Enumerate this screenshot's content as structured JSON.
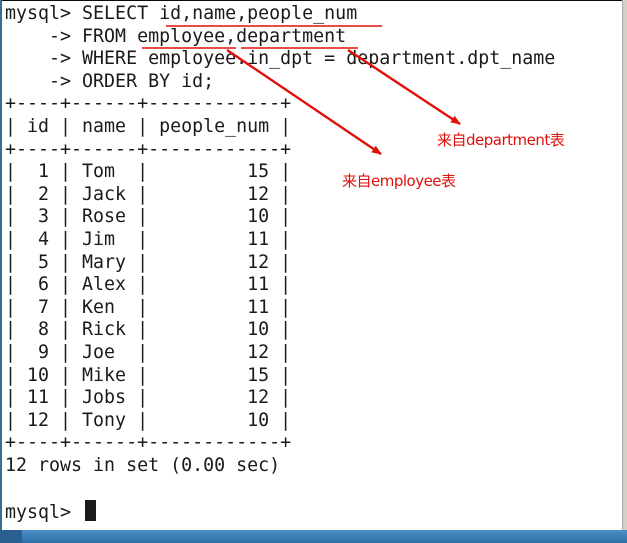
{
  "terminal": {
    "lines": [
      "mysql> SELECT id,name,people_num",
      "    -> FROM employee,department",
      "    -> WHERE employee.in_dpt = department.dpt_name",
      "    -> ORDER BY id;",
      "+----+------+------------+",
      "| id | name | people_num |",
      "+----+------+------------+",
      "|  1 | Tom  |         15 |",
      "|  2 | Jack |         12 |",
      "|  3 | Rose |         10 |",
      "|  4 | Jim  |         11 |",
      "|  5 | Mary |         12 |",
      "|  6 | Alex |         11 |",
      "|  7 | Ken  |         11 |",
      "|  8 | Rick |         10 |",
      "|  9 | Joe  |         12 |",
      "| 10 | Mike |         15 |",
      "| 11 | Jobs |         12 |",
      "| 12 | Tony |         10 |",
      "+----+------+------------+",
      "12 rows in set (0.00 sec)",
      "",
      "mysql> "
    ]
  },
  "annotations": {
    "department_label": "来自department表",
    "employee_label": "来自employee表"
  },
  "colors": {
    "annotation": "#e0100a",
    "terminal_text": "#1a1a1a",
    "background": "#ffffff"
  }
}
